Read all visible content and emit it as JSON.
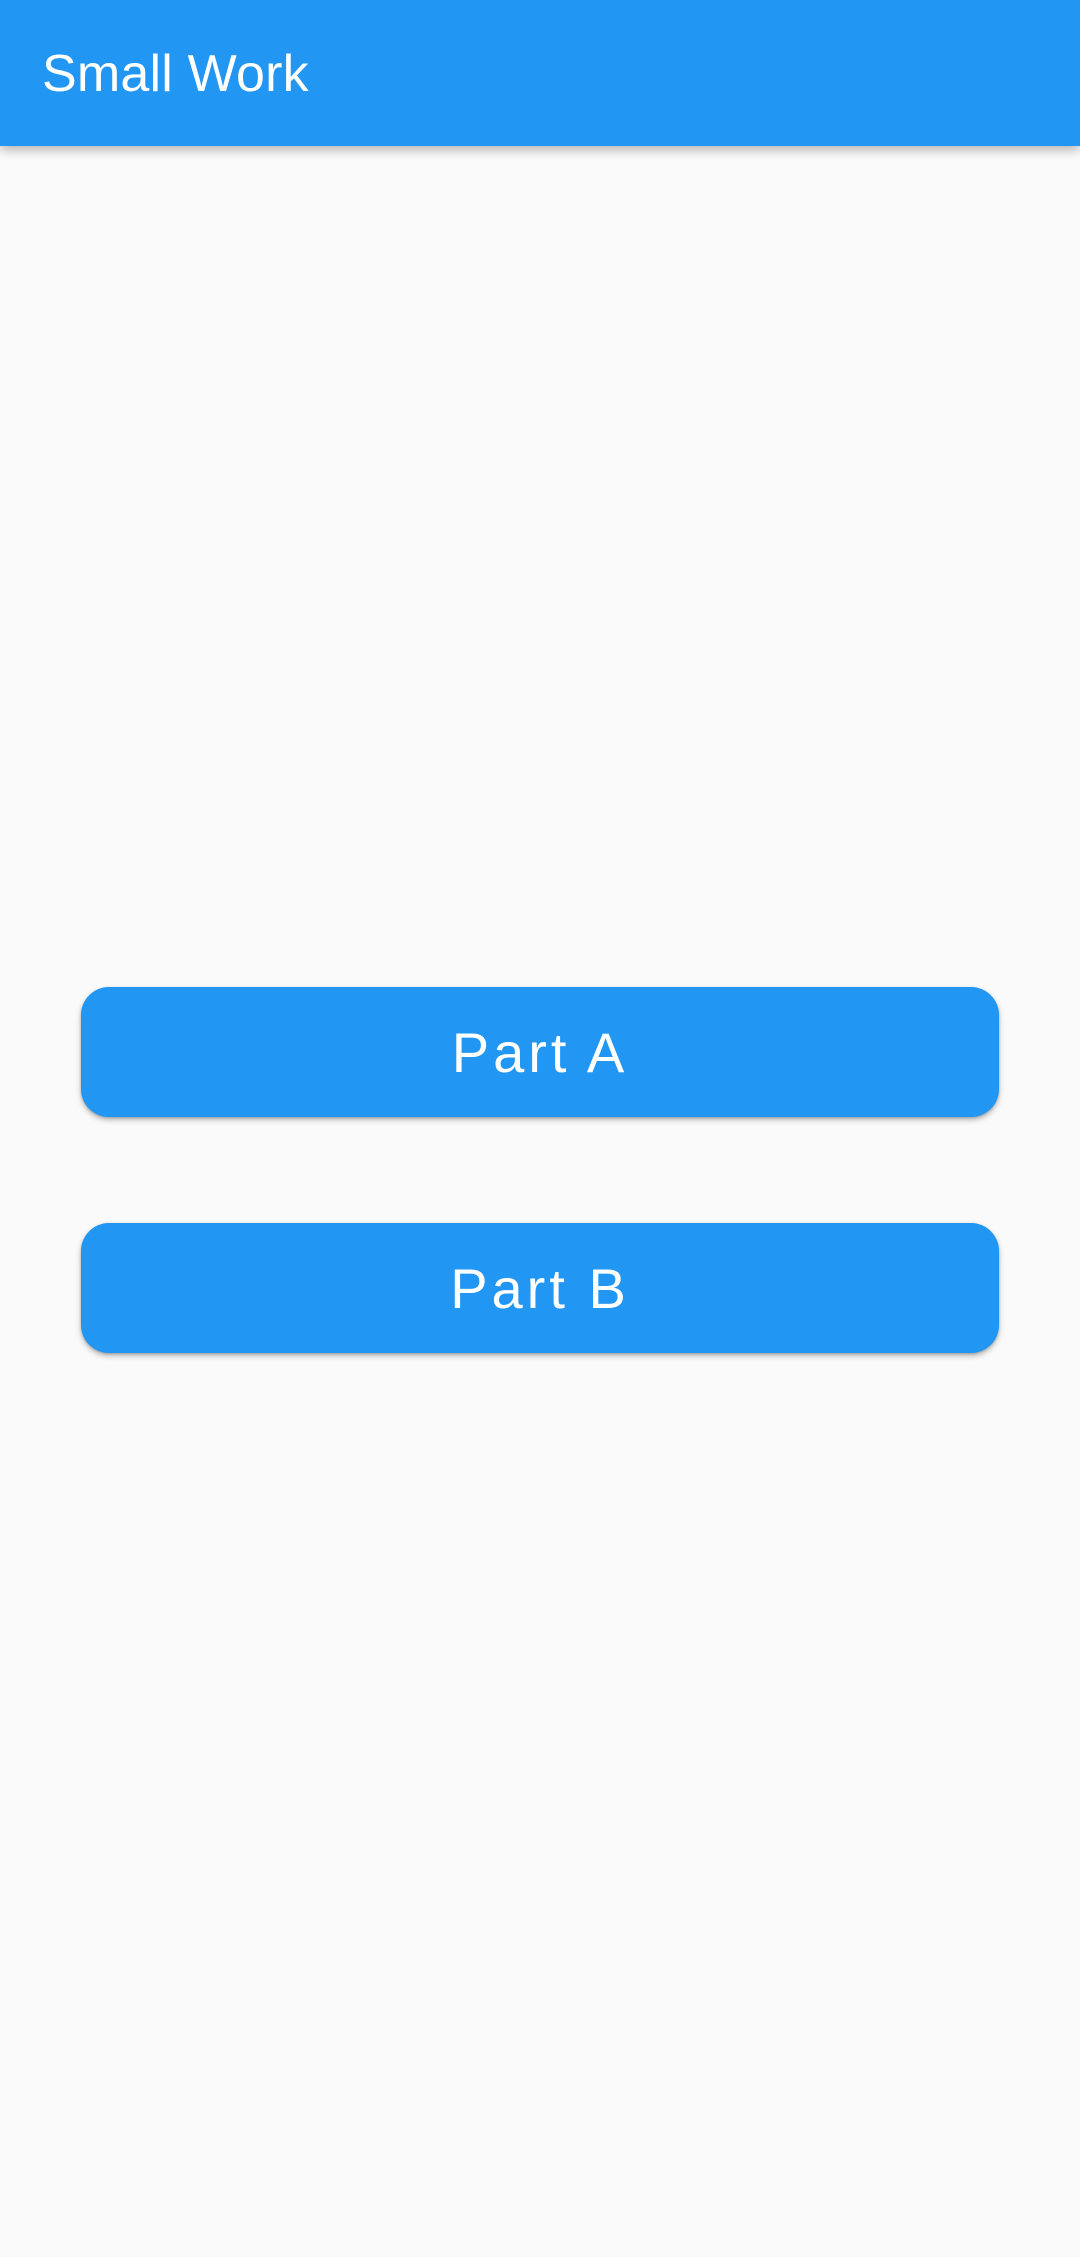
{
  "app_bar": {
    "title": "Small Work",
    "color": "#2196f3"
  },
  "main": {
    "buttons": [
      {
        "label": "Part A"
      },
      {
        "label": "Part B"
      }
    ]
  },
  "colors": {
    "background": "#fafafa",
    "accent": "#2196f3",
    "on_accent": "#ffffff"
  }
}
